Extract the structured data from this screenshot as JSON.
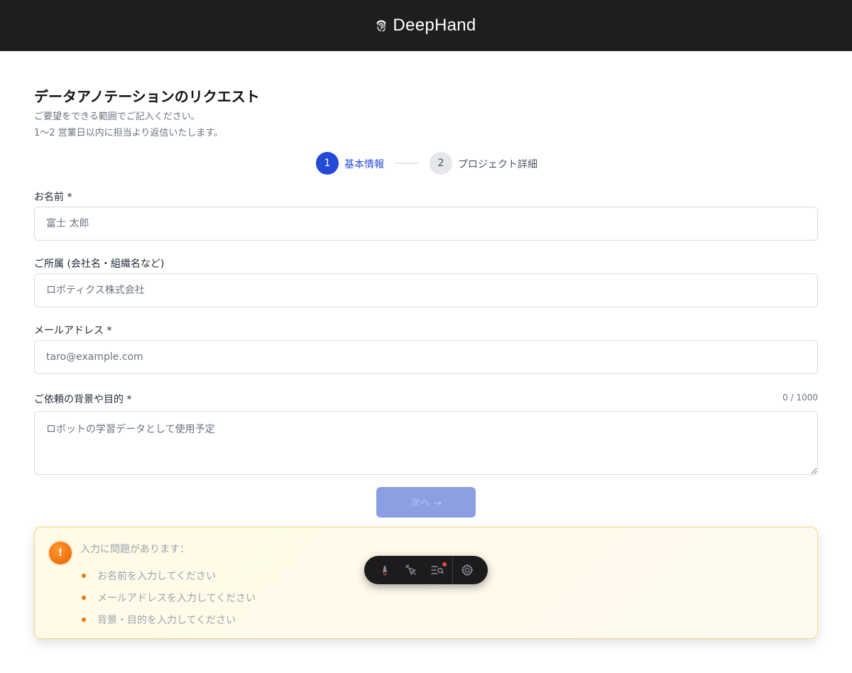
{
  "header": {
    "brand": "DeepHand",
    "logo_icon": "fingerprint-icon"
  },
  "form": {
    "title": "データアノテーションのリクエスト",
    "subtitle_line1": "ご要望をできる範囲でご記入ください。",
    "subtitle_line2": "1〜2 営業日以内に担当より返信いたします。",
    "steps": [
      {
        "number": "1",
        "label": "基本情報",
        "active": true
      },
      {
        "number": "2",
        "label": "プロジェクト詳細",
        "active": false
      }
    ],
    "name": {
      "label": "お名前 *",
      "placeholder": "富士 太郎",
      "value": ""
    },
    "affiliation": {
      "label": "ご所属 (会社名・組織名など)",
      "placeholder": "ロボティクス株式会社",
      "value": ""
    },
    "email": {
      "label": "メールアドレス *",
      "placeholder": "taro@example.com",
      "value": ""
    },
    "purpose": {
      "label": "ご依頼の背景や目的 *",
      "placeholder": "ロボットの学習データとして使用予定",
      "value": "",
      "counter": "0 / 1000"
    },
    "next_label": "次へ →"
  },
  "alert": {
    "icon": "exclamation-icon",
    "title": "入力に問題があります：",
    "errors": [
      "お名前を入力してください",
      "メールアドレスを入力してください",
      "背景・目的を入力してください"
    ],
    "colors": {
      "border": "#f3d77a",
      "bullet": "#e8780c",
      "icon": "#e85d04"
    }
  },
  "floating_toolbar": {
    "buttons": [
      "astro-icon",
      "inspect-cursor-icon",
      "audit-list-icon",
      "settings-gear-icon"
    ]
  },
  "colors": {
    "accent": "#2449d6",
    "header_bg": "#1e1e1e"
  }
}
